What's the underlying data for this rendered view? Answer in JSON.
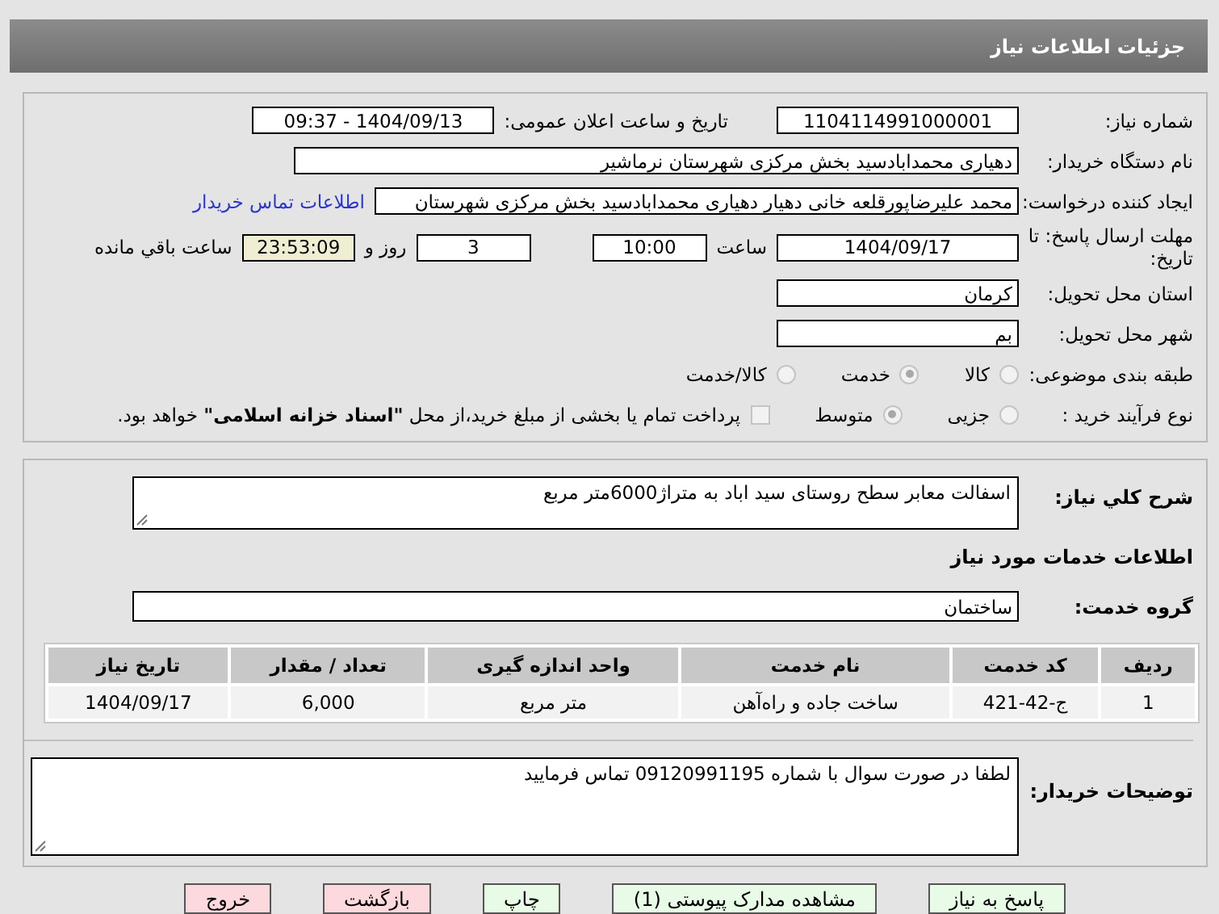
{
  "header": {
    "title": "جزئیات اطلاعات نیاز"
  },
  "details": {
    "need_number": {
      "label": "شماره نیاز:",
      "value": "1104114991000001"
    },
    "announce": {
      "label": "تاریخ و ساعت اعلان عمومی:",
      "value": "1404/09/13 - 09:37"
    },
    "buyer": {
      "label": "نام دستگاه خریدار:",
      "value": "دهیاری محمدابادسید بخش مرکزی شهرستان نرماشیر"
    },
    "creator": {
      "label": "ایجاد کننده درخواست:",
      "value": "محمد علیرضاپورقلعه خانی دهیار دهیاری محمدابادسید بخش مرکزی شهرستان",
      "link": "اطلاعات تماس خریدار"
    },
    "deadline": {
      "label": "مهلت ارسال پاسخ: تا تاریخ:",
      "date": "1404/09/17",
      "time_label": "ساعت",
      "time": "10:00",
      "days": "3",
      "days_label": "روز و",
      "remaining": "23:53:09",
      "remaining_label": "ساعت باقي مانده"
    },
    "province": {
      "label": "استان محل تحویل:",
      "value": "کرمان"
    },
    "city": {
      "label": "شهر محل تحویل:",
      "value": "بم"
    },
    "category": {
      "label": "طبقه بندی موضوعی:",
      "options": [
        {
          "label": "کالا",
          "selected": false
        },
        {
          "label": "خدمت",
          "selected": true
        },
        {
          "label": "کالا/خدمت",
          "selected": false
        }
      ]
    },
    "process": {
      "label": "نوع فرآیند خرید :",
      "options": [
        {
          "label": "جزیی",
          "selected": false
        },
        {
          "label": "متوسط",
          "selected": true
        }
      ],
      "payment": {
        "label": "پرداخت تمام یا بخشی از مبلغ خرید،از محل **\"اسناد خزانه اسلامی\"** خواهد بود.",
        "checked": false
      }
    }
  },
  "summary": {
    "label": "شرح کلي نياز:",
    "value": "اسفالت معابر سطح روستای سید اباد به متراژ6000متر مربع"
  },
  "services_heading": "اطلاعات خدمات مورد نیاز",
  "service_group": {
    "label": "گروه خدمت:",
    "value": "ساختمان"
  },
  "table": {
    "columns": [
      "ردیف",
      "کد خدمت",
      "نام خدمت",
      "واحد اندازه گیری",
      "تعداد / مقدار",
      "تاریخ نیاز"
    ],
    "rows": [
      [
        "1",
        "ج-42-421",
        "ساخت جاده و راه‌آهن",
        "متر مربع",
        "6,000",
        "1404/09/17"
      ]
    ]
  },
  "buyer_notes": {
    "label": "توضیحات خریدار:",
    "value": "لطفا در صورت سوال با شماره 09120991195 تماس فرمایید"
  },
  "buttons": [
    {
      "label": "پاسخ به نیاز",
      "kind": "action"
    },
    {
      "label": "مشاهده مدارک پیوستی (1)",
      "kind": "action"
    },
    {
      "label": "چاپ",
      "kind": "action"
    },
    {
      "label": "بازگشت",
      "kind": "exit"
    },
    {
      "label": "خروج",
      "kind": "exit"
    }
  ]
}
